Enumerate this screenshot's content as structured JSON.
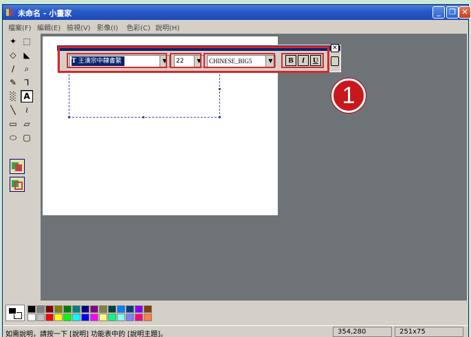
{
  "window": {
    "title": "未命名 - 小畫家",
    "controls": {
      "minimize": "_",
      "maximize": "❐",
      "close": "✕"
    }
  },
  "menubar": {
    "items": [
      {
        "label": "檔案(F)"
      },
      {
        "label": "編輯(E)"
      },
      {
        "label": "檢視(V)"
      },
      {
        "label": "影像(I)"
      },
      {
        "label": "色彩(C)"
      },
      {
        "label": "說明(H)"
      }
    ]
  },
  "tools": [
    {
      "name": "free-form-select",
      "glyph": "✦"
    },
    {
      "name": "rect-select",
      "glyph": "⬚"
    },
    {
      "name": "eraser",
      "glyph": "◇"
    },
    {
      "name": "fill",
      "glyph": "◣"
    },
    {
      "name": "color-picker",
      "glyph": "∕"
    },
    {
      "name": "magnifier",
      "glyph": "⌕"
    },
    {
      "name": "pencil",
      "glyph": "✎"
    },
    {
      "name": "brush",
      "glyph": "⅂"
    },
    {
      "name": "airbrush",
      "glyph": "░"
    },
    {
      "name": "text",
      "glyph": "A"
    },
    {
      "name": "line",
      "glyph": "╲"
    },
    {
      "name": "curve",
      "glyph": "≀"
    },
    {
      "name": "rectangle",
      "glyph": "▭"
    },
    {
      "name": "polygon",
      "glyph": "▱"
    },
    {
      "name": "ellipse",
      "glyph": "⬭"
    },
    {
      "name": "rounded-rect",
      "glyph": "▢"
    }
  ],
  "fontbar": {
    "font_name": "王漢宗中隸書繁",
    "font_size": "22",
    "charset": "CHINESE_BIG5",
    "bold": "B",
    "italic": "I",
    "underline": "U",
    "close": "✕",
    "tt_icon": "T"
  },
  "annotation": {
    "step": "1"
  },
  "colors": {
    "accent": "#d8262a",
    "palette_top": [
      "#000000",
      "#808080",
      "#800000",
      "#808000",
      "#008000",
      "#008080",
      "#000080",
      "#800080",
      "#808040",
      "#004040",
      "#0080ff",
      "#004080",
      "#8000ff",
      "#804000"
    ],
    "palette_bottom": [
      "#ffffff",
      "#c0c0c0",
      "#ff0000",
      "#ffff00",
      "#00ff00",
      "#00ffff",
      "#0000ff",
      "#ff00ff",
      "#ffff80",
      "#00ff80",
      "#80ffff",
      "#8080ff",
      "#ff0080",
      "#ff8040"
    ]
  },
  "status": {
    "help_text": "如需說明，請按一下 [說明] 功能表中的 [說明主題]。",
    "cursor_pos": "354,280",
    "selection_size": "251x75"
  }
}
